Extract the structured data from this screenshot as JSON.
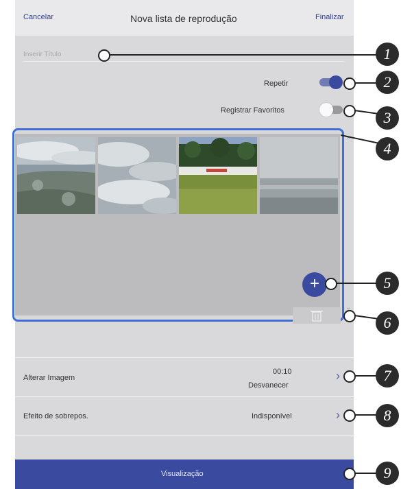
{
  "header": {
    "cancel": "Cancelar",
    "title": "Nova lista de reprodução",
    "finish": "Finalizar"
  },
  "title_field": {
    "placeholder": "Inserir Título"
  },
  "repeat": {
    "label": "Repetir",
    "state": "on"
  },
  "favorites": {
    "label": "Registrar Favoritos",
    "state": "off"
  },
  "thumbnails": {
    "count": 4
  },
  "add_button": {
    "label": "+"
  },
  "change_image": {
    "label": "Alterar Imagem",
    "time": "00:10",
    "effect": "Desvanecer"
  },
  "overlay_effect": {
    "label": "Efeito de sobrepos.",
    "value": "Indisponível"
  },
  "preview_button": {
    "label": "Visualização"
  },
  "callouts": [
    "1",
    "2",
    "3",
    "4",
    "5",
    "6",
    "7",
    "8",
    "9"
  ],
  "colors": {
    "accent": "#3a4a9e",
    "highlight": "#3f6fd6"
  }
}
